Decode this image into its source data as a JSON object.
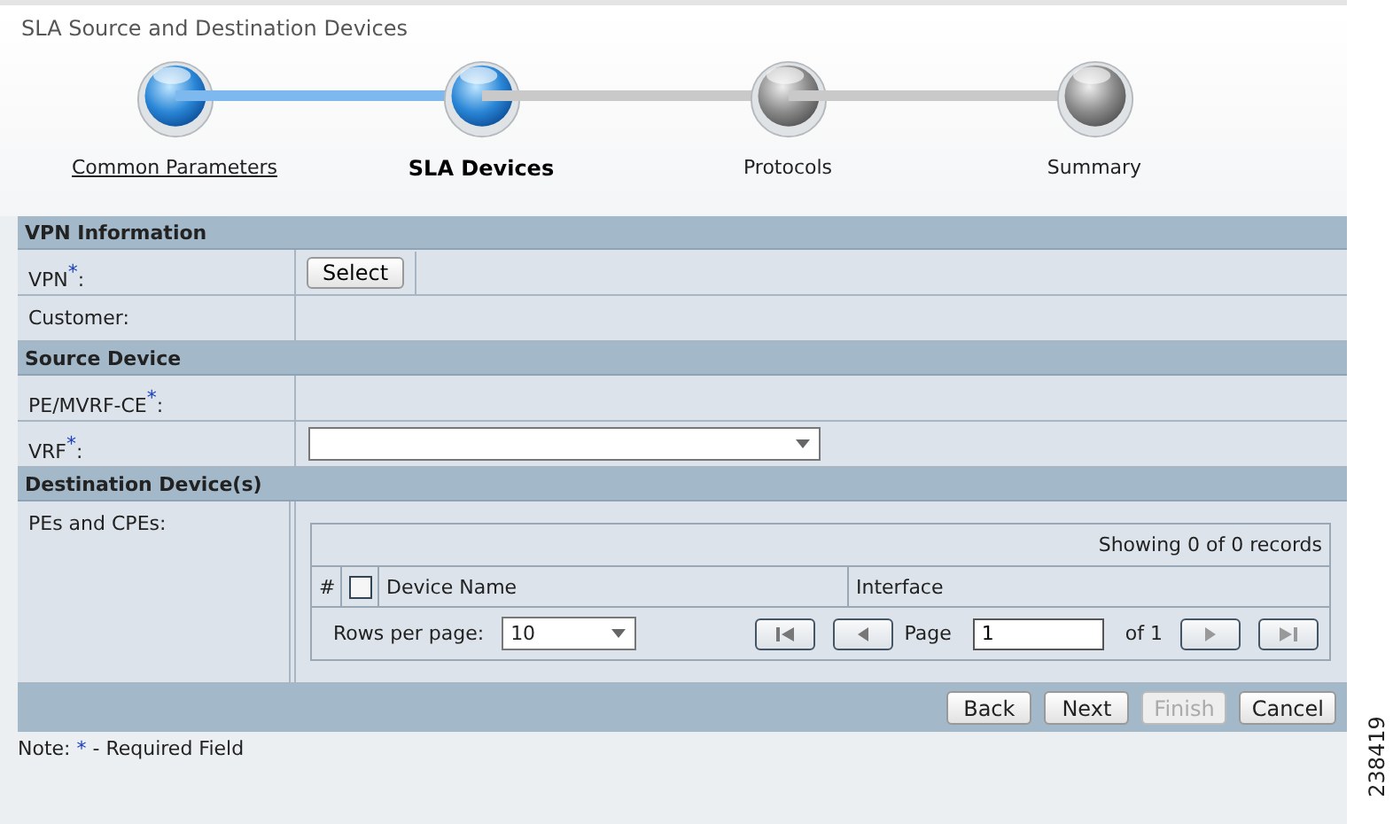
{
  "page_title": "SLA Source and Destination Devices",
  "steps": [
    {
      "label": "Common Parameters",
      "kind": "done"
    },
    {
      "label": "SLA Devices",
      "kind": "current"
    },
    {
      "label": "Protocols",
      "kind": "pending"
    },
    {
      "label": "Summary",
      "kind": "pending"
    }
  ],
  "sections": [
    {
      "title": "VPN Information",
      "rows": [
        {
          "label": "VPN$^{*}$:",
          "kind": "button",
          "button": "Select"
        },
        {
          "label": "Customer:",
          "kind": "empty"
        }
      ]
    },
    {
      "title": "Source Device",
      "rows": [
        {
          "label": "PE/MVRF-CE$^{*}$:",
          "kind": "empty"
        },
        {
          "label": "VRF$^{*}$:",
          "kind": "select"
        }
      ]
    },
    {
      "title": "Destination Device(s)",
      "rows": [
        {
          "label": "PEs and CPEs:",
          "kind": "table"
        }
      ]
    }
  ],
  "table": {
    "summary": "Showing 0 of 0 records",
    "columns": [
      "#",
      "Device Name",
      "Interface"
    ],
    "select_all_checked": false,
    "rows_per_page_label": "Rows per page:",
    "rows_per_page": "10",
    "page_label": "Page",
    "page": "1",
    "of_label": "of 1"
  },
  "buttons": [
    {
      "label": "Back",
      "disabled": false
    },
    {
      "label": "Next",
      "disabled": false
    },
    {
      "label": "Finish",
      "disabled": true
    },
    {
      "label": "Cancel",
      "disabled": false
    }
  ],
  "note": {
    "label": "Note:",
    "mark": "*",
    "text": "- Required Field"
  },
  "figure_number": "238419"
}
